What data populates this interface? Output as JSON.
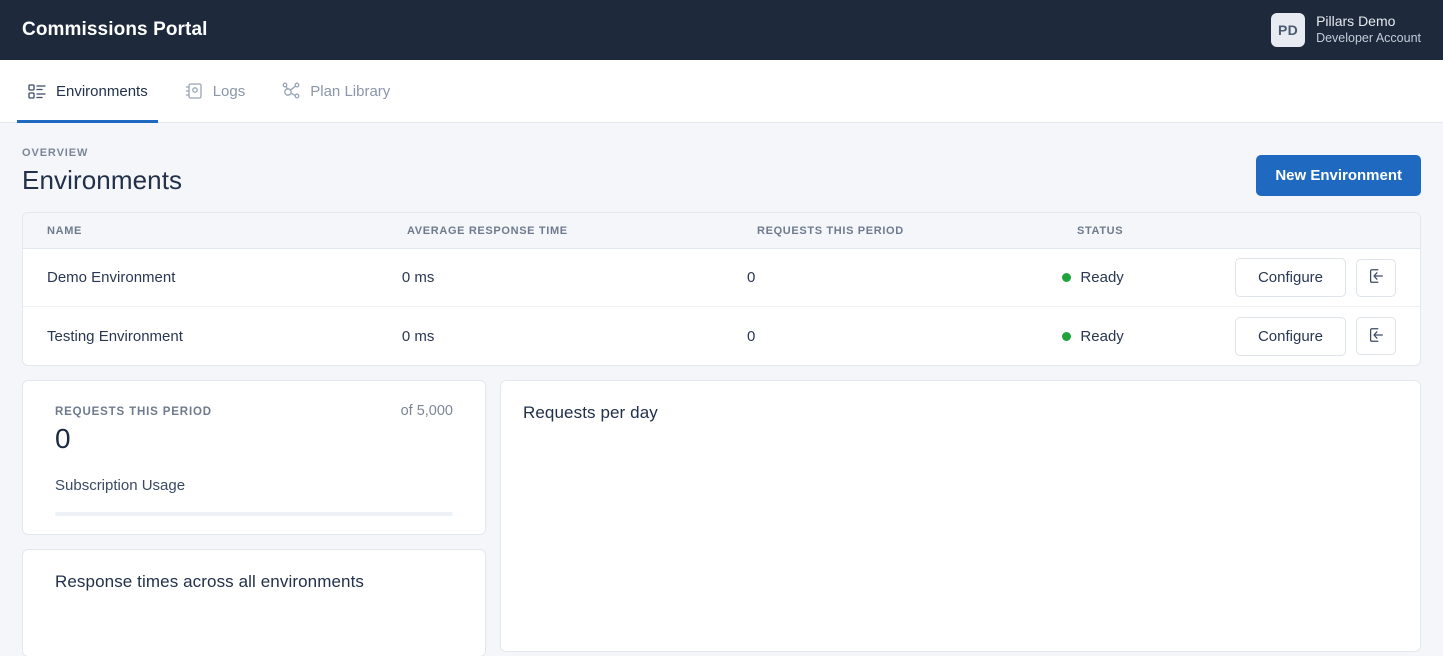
{
  "header": {
    "brand": "Commissions Portal",
    "avatar_initials": "PD",
    "account_name": "Pillars Demo",
    "account_role": "Developer Account"
  },
  "tabs": [
    {
      "label": "Environments",
      "icon": "list-detail-icon",
      "active": true
    },
    {
      "label": "Logs",
      "icon": "contact-book-icon",
      "active": false
    },
    {
      "label": "Plan Library",
      "icon": "node-graph-icon",
      "active": false
    }
  ],
  "page": {
    "eyebrow": "OVERVIEW",
    "title": "Environments",
    "new_button": "New Environment"
  },
  "table": {
    "columns": [
      "NAME",
      "AVERAGE RESPONSE TIME",
      "REQUESTS THIS PERIOD",
      "STATUS"
    ],
    "rows": [
      {
        "name": "Demo Environment",
        "average_response_time": "0 ms",
        "requests_this_period": "0",
        "status": "Ready",
        "configure_label": "Configure",
        "open_icon": "sign-in-arrow-icon"
      },
      {
        "name": "Testing Environment",
        "average_response_time": "0 ms",
        "requests_this_period": "0",
        "status": "Ready",
        "configure_label": "Configure",
        "open_icon": "sign-in-arrow-icon"
      }
    ]
  },
  "usage_card": {
    "label": "REQUESTS THIS PERIOD",
    "limit": "of 5,000",
    "value": "0",
    "subtitle": "Subscription Usage",
    "progress_percent": "0"
  },
  "response_card": {
    "title": "Response times across all environments"
  },
  "chart_card": {
    "title": "Requests per day"
  },
  "colors": {
    "header_bg": "#1e293b",
    "accent_blue": "#1f69c0",
    "status_green": "#1fa33c",
    "page_bg": "#f4f6f9"
  }
}
